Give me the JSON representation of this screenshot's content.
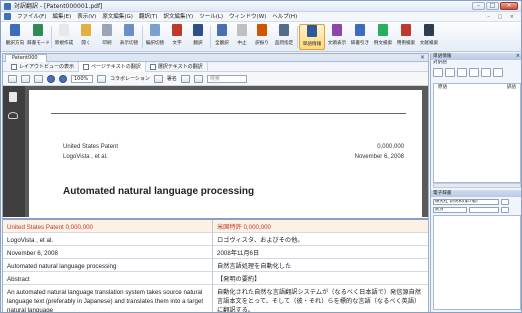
{
  "window": {
    "title": "対訳翻訳 - [Patent000001.pdf]",
    "controls": [
      "–",
      "□",
      "×"
    ]
  },
  "menu": {
    "items": [
      "ファイル(F)",
      "編集(E)",
      "表示(V)",
      "原文編集(G)",
      "翻訳(T)",
      "訳文編集(Y)",
      "ツール(L)",
      "ウィンドウ(W)",
      "ヘルプ(H)"
    ],
    "mdi_controls": "– □ ×"
  },
  "ribbon": {
    "buttons": [
      {
        "label": "翻訳方向",
        "icon": "translate-direction-icon",
        "color": "#3b6cc0",
        "selected": false
      },
      {
        "label": "辞書モード",
        "icon": "dictionary-mode-icon",
        "color": "#2e8b57",
        "selected": false
      },
      {
        "label": "新規作成",
        "icon": "new-file-icon",
        "color": "#e8e8e8",
        "selected": false
      },
      {
        "label": "開く",
        "icon": "open-folder-icon",
        "color": "#e0b040",
        "selected": false
      },
      {
        "label": "印刷",
        "icon": "print-icon",
        "color": "#9aa5b5",
        "selected": false
      },
      {
        "label": "表示切替",
        "icon": "view-switch-icon",
        "color": "#6d8fc8",
        "selected": false
      },
      {
        "label": "編訳切替",
        "icon": "edit-switch-icon",
        "color": "#7aa0d0",
        "selected": false
      },
      {
        "label": "文字",
        "icon": "font-icon",
        "color": "#c0392b",
        "selected": false
      },
      {
        "label": "翻訳",
        "icon": "translate-play-icon",
        "color": "#2f4f8a",
        "selected": false
      },
      {
        "label": "全翻訳",
        "icon": "translate-all-icon",
        "color": "#4a6fb3",
        "selected": false
      },
      {
        "label": "中止",
        "icon": "stop-icon",
        "color": "#c0c0c0",
        "selected": false
      },
      {
        "label": "訳振り",
        "icon": "interlinear-icon",
        "color": "#d35400",
        "selected": false
      },
      {
        "label": "品詞指定",
        "icon": "pos-icon",
        "color": "#556b8a",
        "selected": false
      },
      {
        "label": "単語情報",
        "icon": "word-info-icon",
        "color": "#2e5a9c",
        "selected": true
      },
      {
        "label": "文頭表示",
        "icon": "sentence-head-icon",
        "color": "#8e44ad",
        "selected": false
      },
      {
        "label": "辞書引き",
        "icon": "dictionary-lookup-icon",
        "color": "#3b6cc0",
        "selected": false
      },
      {
        "label": "例文検索",
        "icon": "example-search-icon",
        "color": "#27ae60",
        "selected": false
      },
      {
        "label": "用例検索",
        "icon": "usage-search-icon",
        "color": "#c0392b",
        "selected": false
      },
      {
        "label": "文献検索",
        "icon": "literature-search-icon",
        "color": "#2c3e50",
        "selected": false
      }
    ]
  },
  "document": {
    "tab_label": "Patent000",
    "view_tabs": [
      "レイアウトビューの表示",
      "ページテキストの翻訳",
      "選択テキストの翻訳"
    ],
    "pdf_toolbar": {
      "zoom": "100%",
      "collaboration": "コラボレーション",
      "sign": "署名",
      "search_placeholder": "検索"
    },
    "pdf_page": {
      "patent_label": "United States Patent",
      "patent_number": "0,000,000",
      "author": "LogoVista , et al.",
      "date": "November 6, 2008",
      "title": "Automated natural language processing"
    }
  },
  "translation_grid": {
    "rows": [
      {
        "source": "United States Patent 0,000,000",
        "target": "米国特許 0,000,000"
      },
      {
        "source": "LogoVista , et al.",
        "target": "ロゴヴィスタ、およびその他。"
      },
      {
        "source": "November 6, 2008",
        "target": "2008年11月6日"
      },
      {
        "source": "Automated natural language processing",
        "target": "自然言語処理を自動化した"
      },
      {
        "source": "Abstract",
        "target": "【発明の要約】"
      },
      {
        "source": "An automated natural language translation system takes source natural language text (preferably in Japanese) and translates them into a target natural language",
        "target": "自動化された自然な言語翻訳システムが（なるべく日本語で）発信源自然言語本文をとって、そして（彼・それ）らを標的な言語（なるべく英語）に翻訳する。"
      }
    ]
  },
  "right_pane": {
    "header": "単語情報",
    "subheader": "対訳語",
    "list_col_source": "原語",
    "list_col_target": "訳語",
    "dict_header": "電子辞書",
    "dict_select_1": "研究社 新英和(第7版)",
    "dict_select_2": "前方"
  }
}
